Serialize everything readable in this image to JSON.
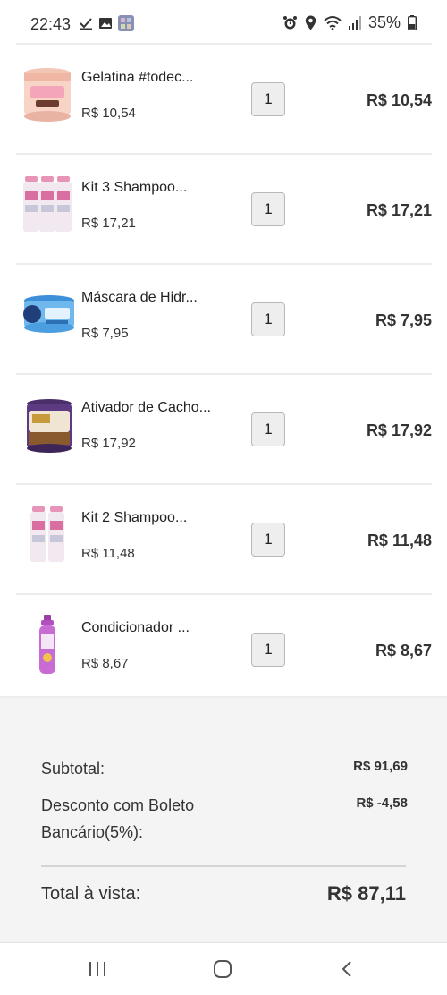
{
  "status_bar": {
    "time": "22:43",
    "battery": "35%",
    "icons_left": [
      "check-download-icon",
      "image-icon",
      "app-icon"
    ],
    "icons_right": [
      "alarm-icon",
      "location-icon",
      "wifi-icon",
      "signal-icon",
      "battery-icon"
    ]
  },
  "cart": {
    "items": [
      {
        "name": "Gelatina #todec...",
        "unit_price": "R$ 10,54",
        "quantity": "1",
        "total": "R$ 10,54"
      },
      {
        "name": "Kit 3 Shampoo...",
        "unit_price": "R$ 17,21",
        "quantity": "1",
        "total": "R$ 17,21"
      },
      {
        "name": "Máscara de Hidr...",
        "unit_price": "R$ 7,95",
        "quantity": "1",
        "total": "R$ 7,95"
      },
      {
        "name": "Ativador de Cacho...",
        "unit_price": "R$ 17,92",
        "quantity": "1",
        "total": "R$ 17,92"
      },
      {
        "name": "Kit 2 Shampoo...",
        "unit_price": "R$ 11,48",
        "quantity": "1",
        "total": "R$ 11,48"
      },
      {
        "name": "Condicionador ...",
        "unit_price": "R$ 8,67",
        "quantity": "1",
        "total": "R$ 8,67"
      }
    ]
  },
  "summary": {
    "subtotal_label": "Subtotal:",
    "subtotal_value": "R$ 91,69",
    "discount_label_line1": "Desconto com Boleto",
    "discount_label_line2": "Bancário(5%):",
    "discount_value": "R$ -4,58",
    "total_label": "Total à vista:",
    "total_value": "R$ 87,11"
  },
  "nav": {
    "recents": "recents-icon",
    "home": "home-icon",
    "back": "back-icon"
  }
}
